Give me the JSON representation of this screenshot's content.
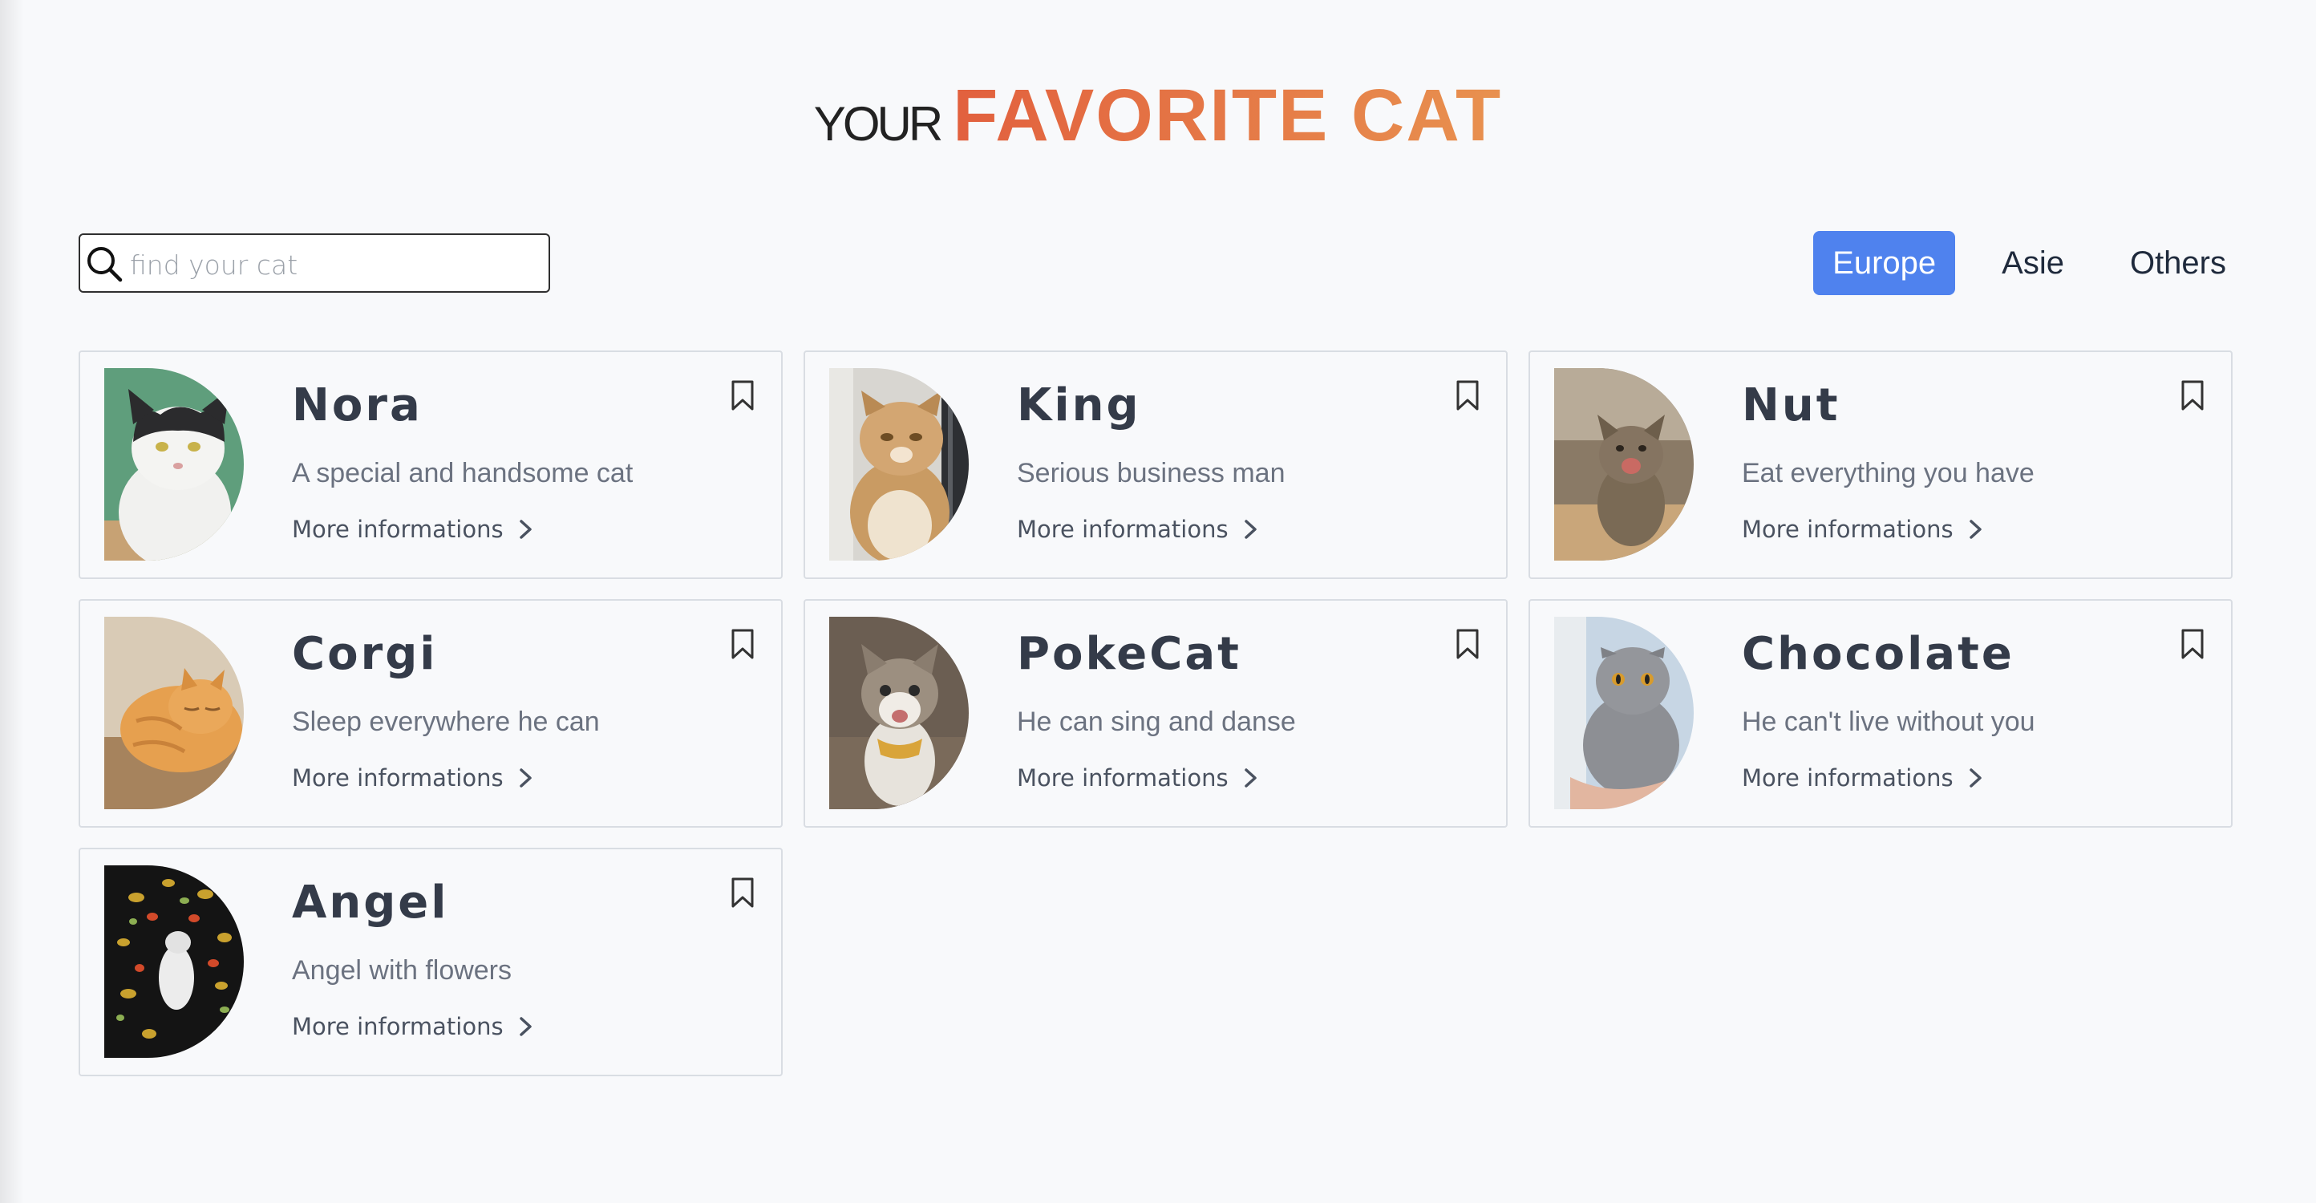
{
  "header": {
    "title_prefix": "YOUR",
    "title_main": "FAVORITE CAT"
  },
  "search": {
    "placeholder": "find your cat",
    "value": ""
  },
  "tabs": [
    {
      "label": "Europe",
      "active": true
    },
    {
      "label": "Asie",
      "active": false
    },
    {
      "label": "Others",
      "active": false
    }
  ],
  "cats": [
    {
      "name": "Nora",
      "description": "A special and handsome cat",
      "link": "More informations"
    },
    {
      "name": "King",
      "description": "Serious business man",
      "link": "More informations"
    },
    {
      "name": "Nut",
      "description": "Eat everything you have",
      "link": "More informations"
    },
    {
      "name": "Corgi",
      "description": "Sleep everywhere he can",
      "link": "More informations"
    },
    {
      "name": "PokeCat",
      "description": "He can sing and danse",
      "link": "More informations"
    },
    {
      "name": "Chocolate",
      "description": "He can't live without you",
      "link": "More informations"
    },
    {
      "name": "Angel",
      "description": "Angel with flowers",
      "link": "More informations"
    }
  ],
  "colors": {
    "accent": "#4f82ee",
    "title_gradient_start": "#e2603e",
    "title_gradient_end": "#e8914f"
  },
  "icons": {
    "search": "search-icon",
    "bookmark": "bookmark-icon",
    "chevron": "chevron-right-icon"
  }
}
